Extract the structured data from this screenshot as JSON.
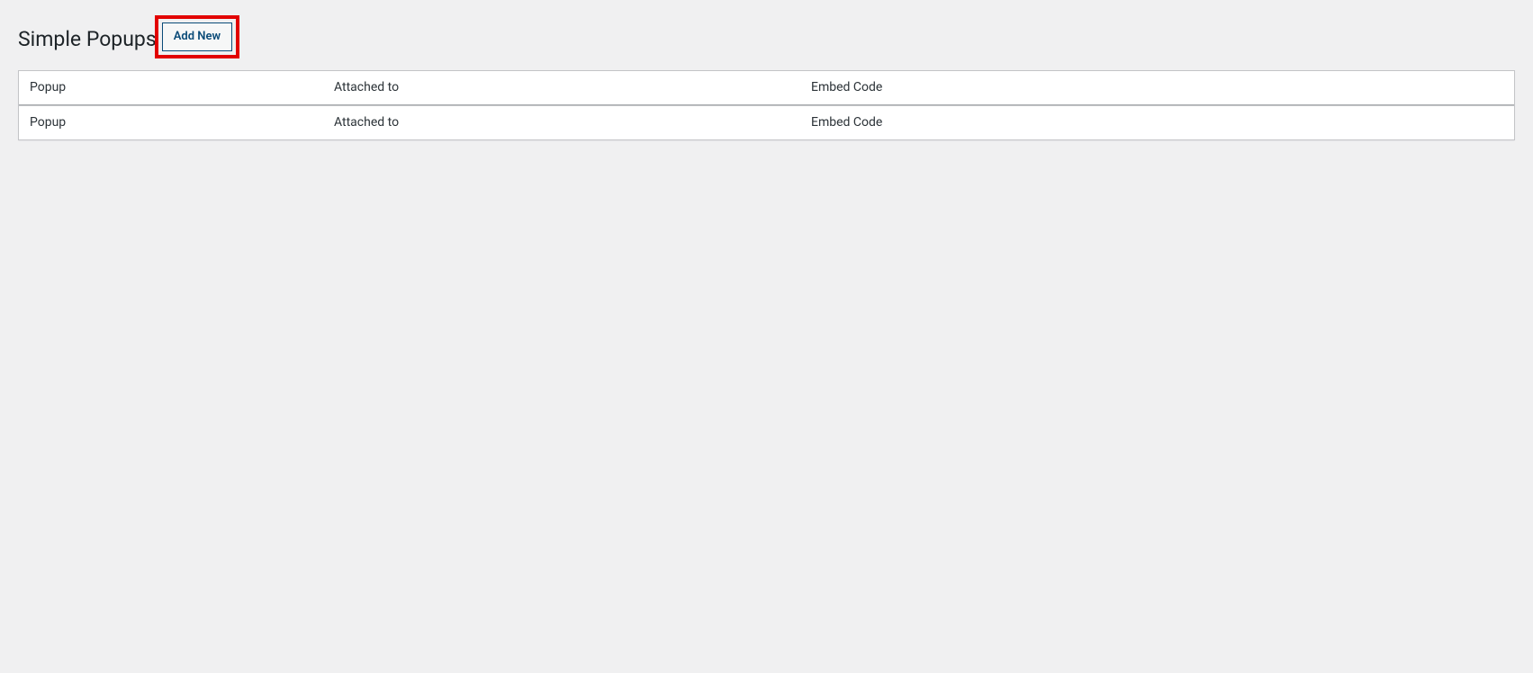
{
  "header": {
    "title": "Simple Popups",
    "add_new_label": "Add New"
  },
  "table": {
    "columns": {
      "popup": "Popup",
      "attached": "Attached to",
      "embed": "Embed Code"
    },
    "footer": {
      "popup": "Popup",
      "attached": "Attached to",
      "embed": "Embed Code"
    }
  }
}
